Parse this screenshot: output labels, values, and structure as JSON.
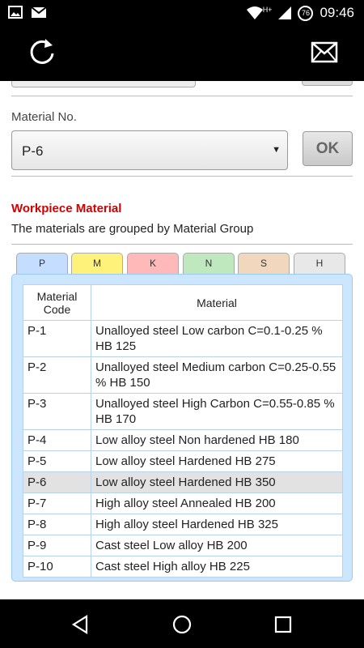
{
  "status": {
    "time": "09:46",
    "network": "H+",
    "battery": "76"
  },
  "form": {
    "material_no_label": "Material No.",
    "material_no_value": "P-6",
    "ok_label": "OK"
  },
  "section": {
    "title": "Workpiece Material",
    "subtitle": "The materials are grouped by Material Group"
  },
  "tabs": [
    {
      "label": "P",
      "color": "#c5ddff"
    },
    {
      "label": "M",
      "color": "#fff27a"
    },
    {
      "label": "K",
      "color": "#ffb9b9"
    },
    {
      "label": "N",
      "color": "#bfe8bf"
    },
    {
      "label": "S",
      "color": "#f2d7bf"
    },
    {
      "label": "H",
      "color": "#e8e8e8"
    }
  ],
  "table": {
    "headers": [
      "Material Code",
      "Material"
    ],
    "rows": [
      {
        "code": "P-1",
        "material": "Unalloyed steel Low carbon C=0.1-0.25 % HB 125"
      },
      {
        "code": "P-2",
        "material": "Unalloyed steel Medium carbon C=0.25-0.55 % HB 150"
      },
      {
        "code": "P-3",
        "material": "Unalloyed steel High Carbon C=0.55-0.85 % HB 170"
      },
      {
        "code": "P-4",
        "material": "Low alloy steel Non hardened HB 180"
      },
      {
        "code": "P-5",
        "material": "Low alloy steel Hardened HB 275"
      },
      {
        "code": "P-6",
        "material": "Low alloy steel Hardened HB 350"
      },
      {
        "code": "P-7",
        "material": "High alloy steel Annealed HB 200"
      },
      {
        "code": "P-8",
        "material": "High alloy steel Hardened HB 325"
      },
      {
        "code": "P-9",
        "material": "Cast steel Low alloy HB 200"
      },
      {
        "code": "P-10",
        "material": "Cast steel High alloy HB 225"
      }
    ],
    "selected_code": "P-6"
  },
  "icons": {
    "refresh": "refresh-icon",
    "mail": "mail-icon",
    "back": "back-icon",
    "home": "home-icon",
    "recents": "recents-icon"
  }
}
